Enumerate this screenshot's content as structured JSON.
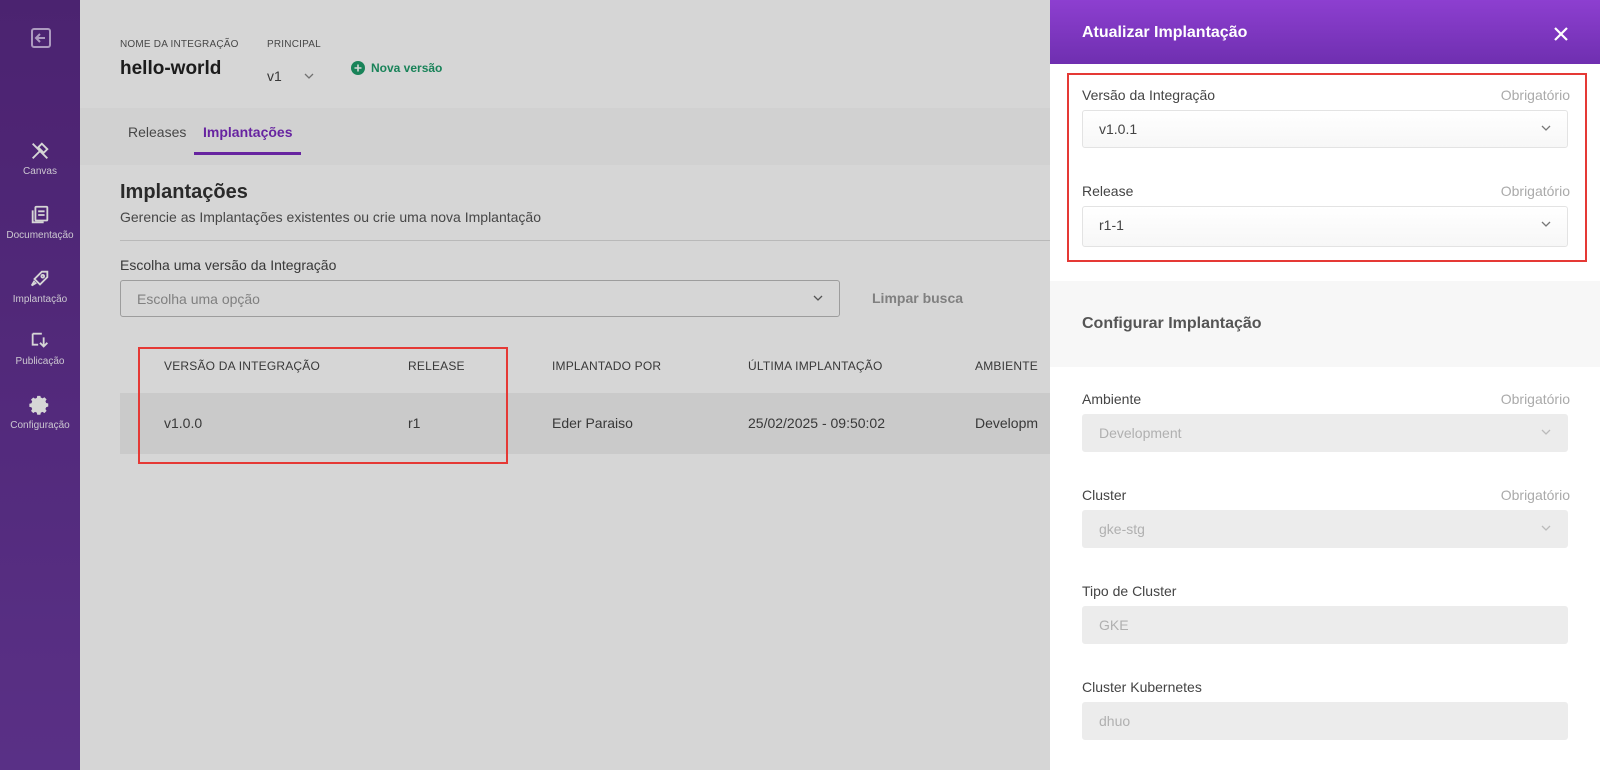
{
  "sidebar": {
    "items": [
      {
        "label": "Canvas",
        "icon": "canvas-icon"
      },
      {
        "label": "Documentação",
        "icon": "documentation-icon"
      },
      {
        "label": "Implantação",
        "icon": "rocket-icon"
      },
      {
        "label": "Publicação",
        "icon": "publish-icon"
      },
      {
        "label": "Configuração",
        "icon": "gear-icon"
      }
    ]
  },
  "header": {
    "name_label": "NOME DA INTEGRAÇÃO",
    "name": "hello-world",
    "principal_label": "PRINCIPAL",
    "principal_value": "v1",
    "new_version": "Nova versão"
  },
  "tabs": [
    {
      "label": "Releases",
      "active": false
    },
    {
      "label": "Implantações",
      "active": true
    }
  ],
  "content": {
    "title": "Implantações",
    "subtitle": "Gerencie as Implantações existentes ou crie uma nova Implantação",
    "filter_label": "Escolha uma versão da Integração",
    "filter_placeholder": "Escolha uma opção",
    "clear_label": "Limpar busca"
  },
  "table": {
    "headers": [
      "VERSÃO DA INTEGRAÇÃO",
      "RELEASE",
      "IMPLANTADO POR",
      "ÚLTIMA IMPLANTAÇÃO",
      "AMBIENTE"
    ],
    "rows": [
      [
        "v1.0.0",
        "r1",
        "Eder Paraiso",
        "25/02/2025 - 09:50:02",
        "Developm"
      ]
    ]
  },
  "panel": {
    "title": "Atualizar Implantação",
    "required_text": "Obrigatório",
    "version_label": "Versão da Integração",
    "version_value": "v1.0.1",
    "release_label": "Release",
    "release_value": "r1-1",
    "section_title": "Configurar Implantação",
    "ambiente_label": "Ambiente",
    "ambiente_value": "Development",
    "cluster_label": "Cluster",
    "cluster_value": "gke-stg",
    "cluster_type_label": "Tipo de Cluster",
    "cluster_type_value": "GKE",
    "k8s_label": "Cluster Kubernetes",
    "k8s_value": "dhuo"
  },
  "colors": {
    "sidebar": "#5a2a86",
    "accent": "#7b2cbf",
    "new_version": "#1e9c6a",
    "highlight": "#e53935"
  }
}
